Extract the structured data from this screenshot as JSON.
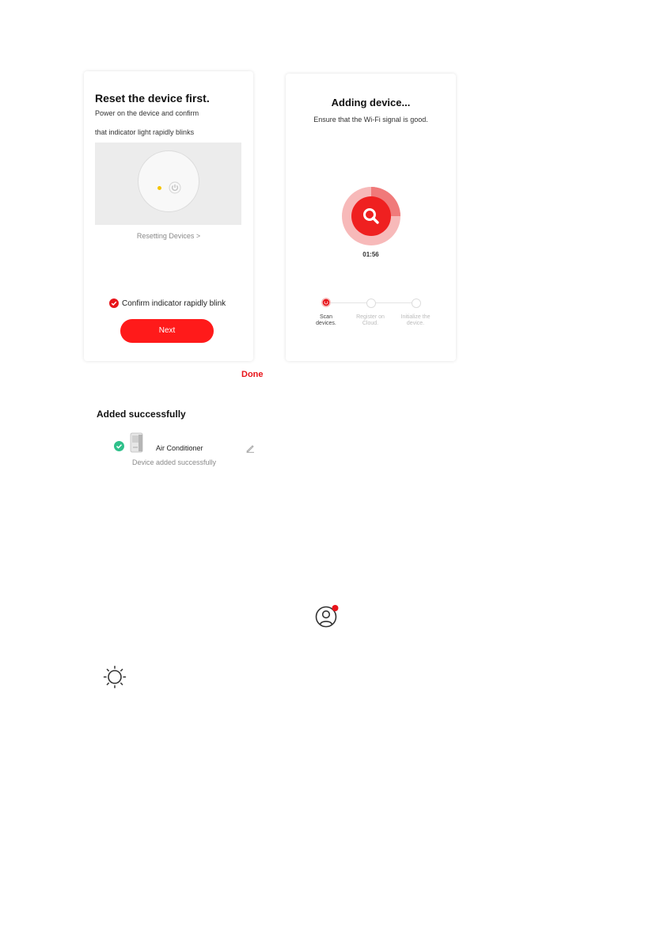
{
  "reset_card": {
    "title": "Reset the device first.",
    "instruction_line1": "Power on the device and confirm",
    "instruction_line2": "that indicator light rapidly blinks",
    "reset_link": "Resetting Devices >",
    "confirm_label": "Confirm indicator rapidly blink",
    "next_label": "Next"
  },
  "adding_card": {
    "title": "Adding device...",
    "subtitle": "Ensure that the Wi-Fi signal is good.",
    "timer": "01:56",
    "steps": [
      {
        "label_line1": "Scan",
        "label_line2": "devices.",
        "state": "active"
      },
      {
        "label_line1": "Register on",
        "label_line2": "Cloud.",
        "state": "pending"
      },
      {
        "label_line1": "Initialize the",
        "label_line2": "device.",
        "state": "pending"
      }
    ]
  },
  "done_label": "Done",
  "added": {
    "title": "Added successfully",
    "device_name": "Air Conditioner",
    "status": "Device added successfully"
  },
  "colors": {
    "accent_red": "#ff1a1a",
    "success_green": "#2ec08a"
  },
  "icons": {
    "profile": "profile-icon",
    "brightness": "brightness-icon",
    "edit": "edit-icon",
    "search": "search-icon"
  }
}
